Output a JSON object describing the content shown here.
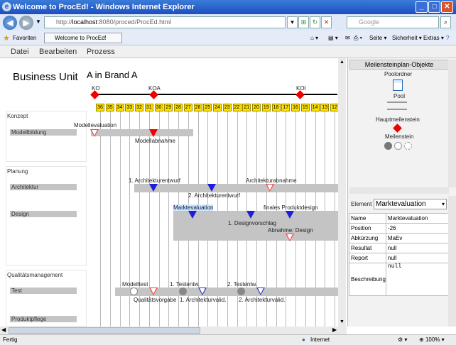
{
  "window": {
    "title": "Welcome to ProcEd! - Windows Internet Explorer"
  },
  "address": {
    "host": "localhost",
    "url_rest": ":8080/proced/ProcEd.html",
    "url_prefix": "http://"
  },
  "search": {
    "placeholder": "Google"
  },
  "favorites": {
    "label": "Favoriten",
    "tab": "Welcome to ProcEd!",
    "seite": "Seite",
    "sicherheit": "Sicherheit",
    "extras": "Extras"
  },
  "menu": {
    "datei": "Datei",
    "bearbeiten": "Bearbeiten",
    "prozess": "Prozess"
  },
  "header": {
    "title": "Business Unit",
    "brand": "A in Brand A"
  },
  "hauptmeilensteine": [
    {
      "label": "KO"
    },
    {
      "label": "KOA"
    },
    {
      "label": "KOI"
    }
  ],
  "weeks": [
    "36",
    "35",
    "34",
    "33",
    "32",
    "31",
    "30",
    "29",
    "28",
    "27",
    "26",
    "25",
    "24",
    "23",
    "22",
    "21",
    "20",
    "19",
    "18",
    "17",
    "16",
    "15",
    "14",
    "13",
    "12"
  ],
  "phases": {
    "konzept": "Konzept",
    "modellbildung": "Modellbildung",
    "planung": "Planung",
    "architektur": "Architektur",
    "design": "Design",
    "qm": "Qualitätsmanagement",
    "test": "Test",
    "produktpflege": "Produktpflege"
  },
  "milestones": {
    "modellevaluation": "Modellevaluation",
    "modellabnahme": "Modellabnahme",
    "arch1": "1. Architekturentwurf",
    "archabnahme": "Architekturabnahme",
    "arch2": "2. Architekturentwurf",
    "marktevaluation": "Marktevaluation",
    "finales": "finales Produktdesign",
    "designvorschlag": "1. Designvorschlag",
    "abnahmedesign": "Abnahme: Design",
    "modelltest": "Modelltest",
    "testentw1": "1. Testentw.",
    "testentw2": "2. Testentw.",
    "qualvorgabe": "Qualitätsvorgabe",
    "archvalid1": "1. Architekturvalid.",
    "archvalid2": "2. Architekturvalid."
  },
  "palette": {
    "title": "Meilensteinplan-Objekte",
    "poolordner": "Poolordner",
    "pool": "Pool",
    "hauptmeilenstein": "Hauptmeilenstein",
    "meilenstein": "Meilenstein"
  },
  "properties": {
    "element_label": "Element",
    "element_value": "Marktevaluation",
    "rows": [
      {
        "key": "Name",
        "value": "Marktevaluation"
      },
      {
        "key": "Position",
        "value": "-26"
      },
      {
        "key": "Abkürzung",
        "value": "MaEv"
      },
      {
        "key": "Resultat",
        "value": "null"
      },
      {
        "key": "Report",
        "value": "null"
      }
    ],
    "beschreibung_label": "Beschreibung",
    "beschreibung_value": "null"
  },
  "status": {
    "left": "Fertig",
    "zone": "Internet",
    "zoom": "100%"
  }
}
